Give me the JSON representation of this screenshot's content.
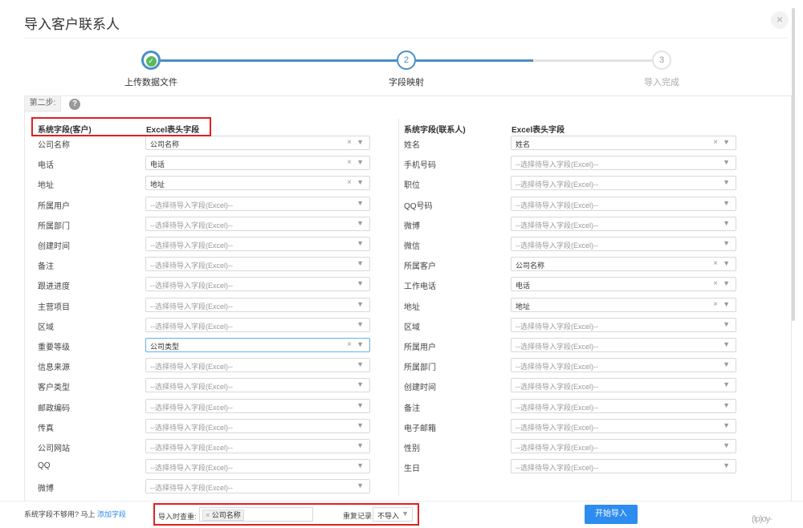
{
  "dialog": {
    "title": "导入客户联系人",
    "close_glyph": "×"
  },
  "stepper": {
    "steps": [
      {
        "label": "上传数据文件",
        "marker": "✓",
        "state": "done"
      },
      {
        "label": "字段映射",
        "marker": "2",
        "state": "active"
      },
      {
        "label": "导入完成",
        "marker": "3",
        "state": "pending"
      }
    ],
    "accent_color": "#4a8fc7"
  },
  "panel": {
    "step_tag": "第二步:",
    "help_icon": "?"
  },
  "left": {
    "col_field": "系统字段(客户)",
    "col_excel": "Excel表头字段",
    "rows": [
      {
        "label": "公司名称",
        "value": "公司名称",
        "placeholder": false
      },
      {
        "label": "电话",
        "value": "电话",
        "placeholder": false
      },
      {
        "label": "地址",
        "value": "地址",
        "placeholder": false
      },
      {
        "label": "所属用户",
        "value": "--选择待导入字段(Excel)--",
        "placeholder": true
      },
      {
        "label": "所属部门",
        "value": "--选择待导入字段(Excel)--",
        "placeholder": true
      },
      {
        "label": "创建时间",
        "value": "--选择待导入字段(Excel)--",
        "placeholder": true
      },
      {
        "label": "备注",
        "value": "--选择待导入字段(Excel)--",
        "placeholder": true
      },
      {
        "label": "跟进进度",
        "value": "--选择待导入字段(Excel)--",
        "placeholder": true
      },
      {
        "label": "主营项目",
        "value": "--选择待导入字段(Excel)--",
        "placeholder": true
      },
      {
        "label": "区域",
        "value": "--选择待导入字段(Excel)--",
        "placeholder": true
      },
      {
        "label": "重要等级",
        "value": "公司类型",
        "placeholder": false,
        "highlight": true
      },
      {
        "label": "信息来源",
        "value": "--选择待导入字段(Excel)--",
        "placeholder": true
      },
      {
        "label": "客户类型",
        "value": "--选择待导入字段(Excel)--",
        "placeholder": true
      },
      {
        "label": "邮政编码",
        "value": "--选择待导入字段(Excel)--",
        "placeholder": true
      },
      {
        "label": "传真",
        "value": "--选择待导入字段(Excel)--",
        "placeholder": true
      },
      {
        "label": "公司网站",
        "value": "--选择待导入字段(Excel)--",
        "placeholder": true
      },
      {
        "label": "QQ",
        "value": "--选择待导入字段(Excel)--",
        "placeholder": true
      },
      {
        "label": "微博",
        "value": "--选择待导入字段(Excel)--",
        "placeholder": true
      }
    ]
  },
  "right": {
    "col_field": "系统字段(联系人)",
    "col_excel": "Excel表头字段",
    "rows": [
      {
        "label": "姓名",
        "value": "姓名",
        "placeholder": false
      },
      {
        "label": "手机号码",
        "value": "--选择待导入字段(Excel)--",
        "placeholder": true
      },
      {
        "label": "职位",
        "value": "--选择待导入字段(Excel)--",
        "placeholder": true
      },
      {
        "label": "QQ号码",
        "value": "--选择待导入字段(Excel)--",
        "placeholder": true
      },
      {
        "label": "微博",
        "value": "--选择待导入字段(Excel)--",
        "placeholder": true
      },
      {
        "label": "微信",
        "value": "--选择待导入字段(Excel)--",
        "placeholder": true
      },
      {
        "label": "所属客户",
        "value": "公司名称",
        "placeholder": false
      },
      {
        "label": "工作电话",
        "value": "电话",
        "placeholder": false
      },
      {
        "label": "地址",
        "value": "地址",
        "placeholder": false
      },
      {
        "label": "区域",
        "value": "--选择待导入字段(Excel)--",
        "placeholder": true
      },
      {
        "label": "所属用户",
        "value": "--选择待导入字段(Excel)--",
        "placeholder": true
      },
      {
        "label": "所属部门",
        "value": "--选择待导入字段(Excel)--",
        "placeholder": true
      },
      {
        "label": "创建时间",
        "value": "--选择待导入字段(Excel)--",
        "placeholder": true
      },
      {
        "label": "备注",
        "value": "--选择待导入字段(Excel)--",
        "placeholder": true
      },
      {
        "label": "电子邮箱",
        "value": "--选择待导入字段(Excel)--",
        "placeholder": true
      },
      {
        "label": "性别",
        "value": "--选择待导入字段(Excel)--",
        "placeholder": true
      },
      {
        "label": "生日",
        "value": "--选择待导入字段(Excel)--",
        "placeholder": true
      }
    ]
  },
  "footer": {
    "hint_text": "系统字段不够用? 马上",
    "add_field_link": "添加字段",
    "dedupe_label": "导入时查重:",
    "dedupe_tag": "公司名称",
    "dedupe_tag_remove": "×",
    "duplicate_label": "重复记录",
    "duplicate_value": "不导入",
    "start_button": "开始导入",
    "corner_logo": "(Ip)oy-"
  },
  "colors": {
    "primary_button": "#2d8cf0",
    "annotation_red": "#e02020",
    "step_done": "#4a8fc7"
  }
}
